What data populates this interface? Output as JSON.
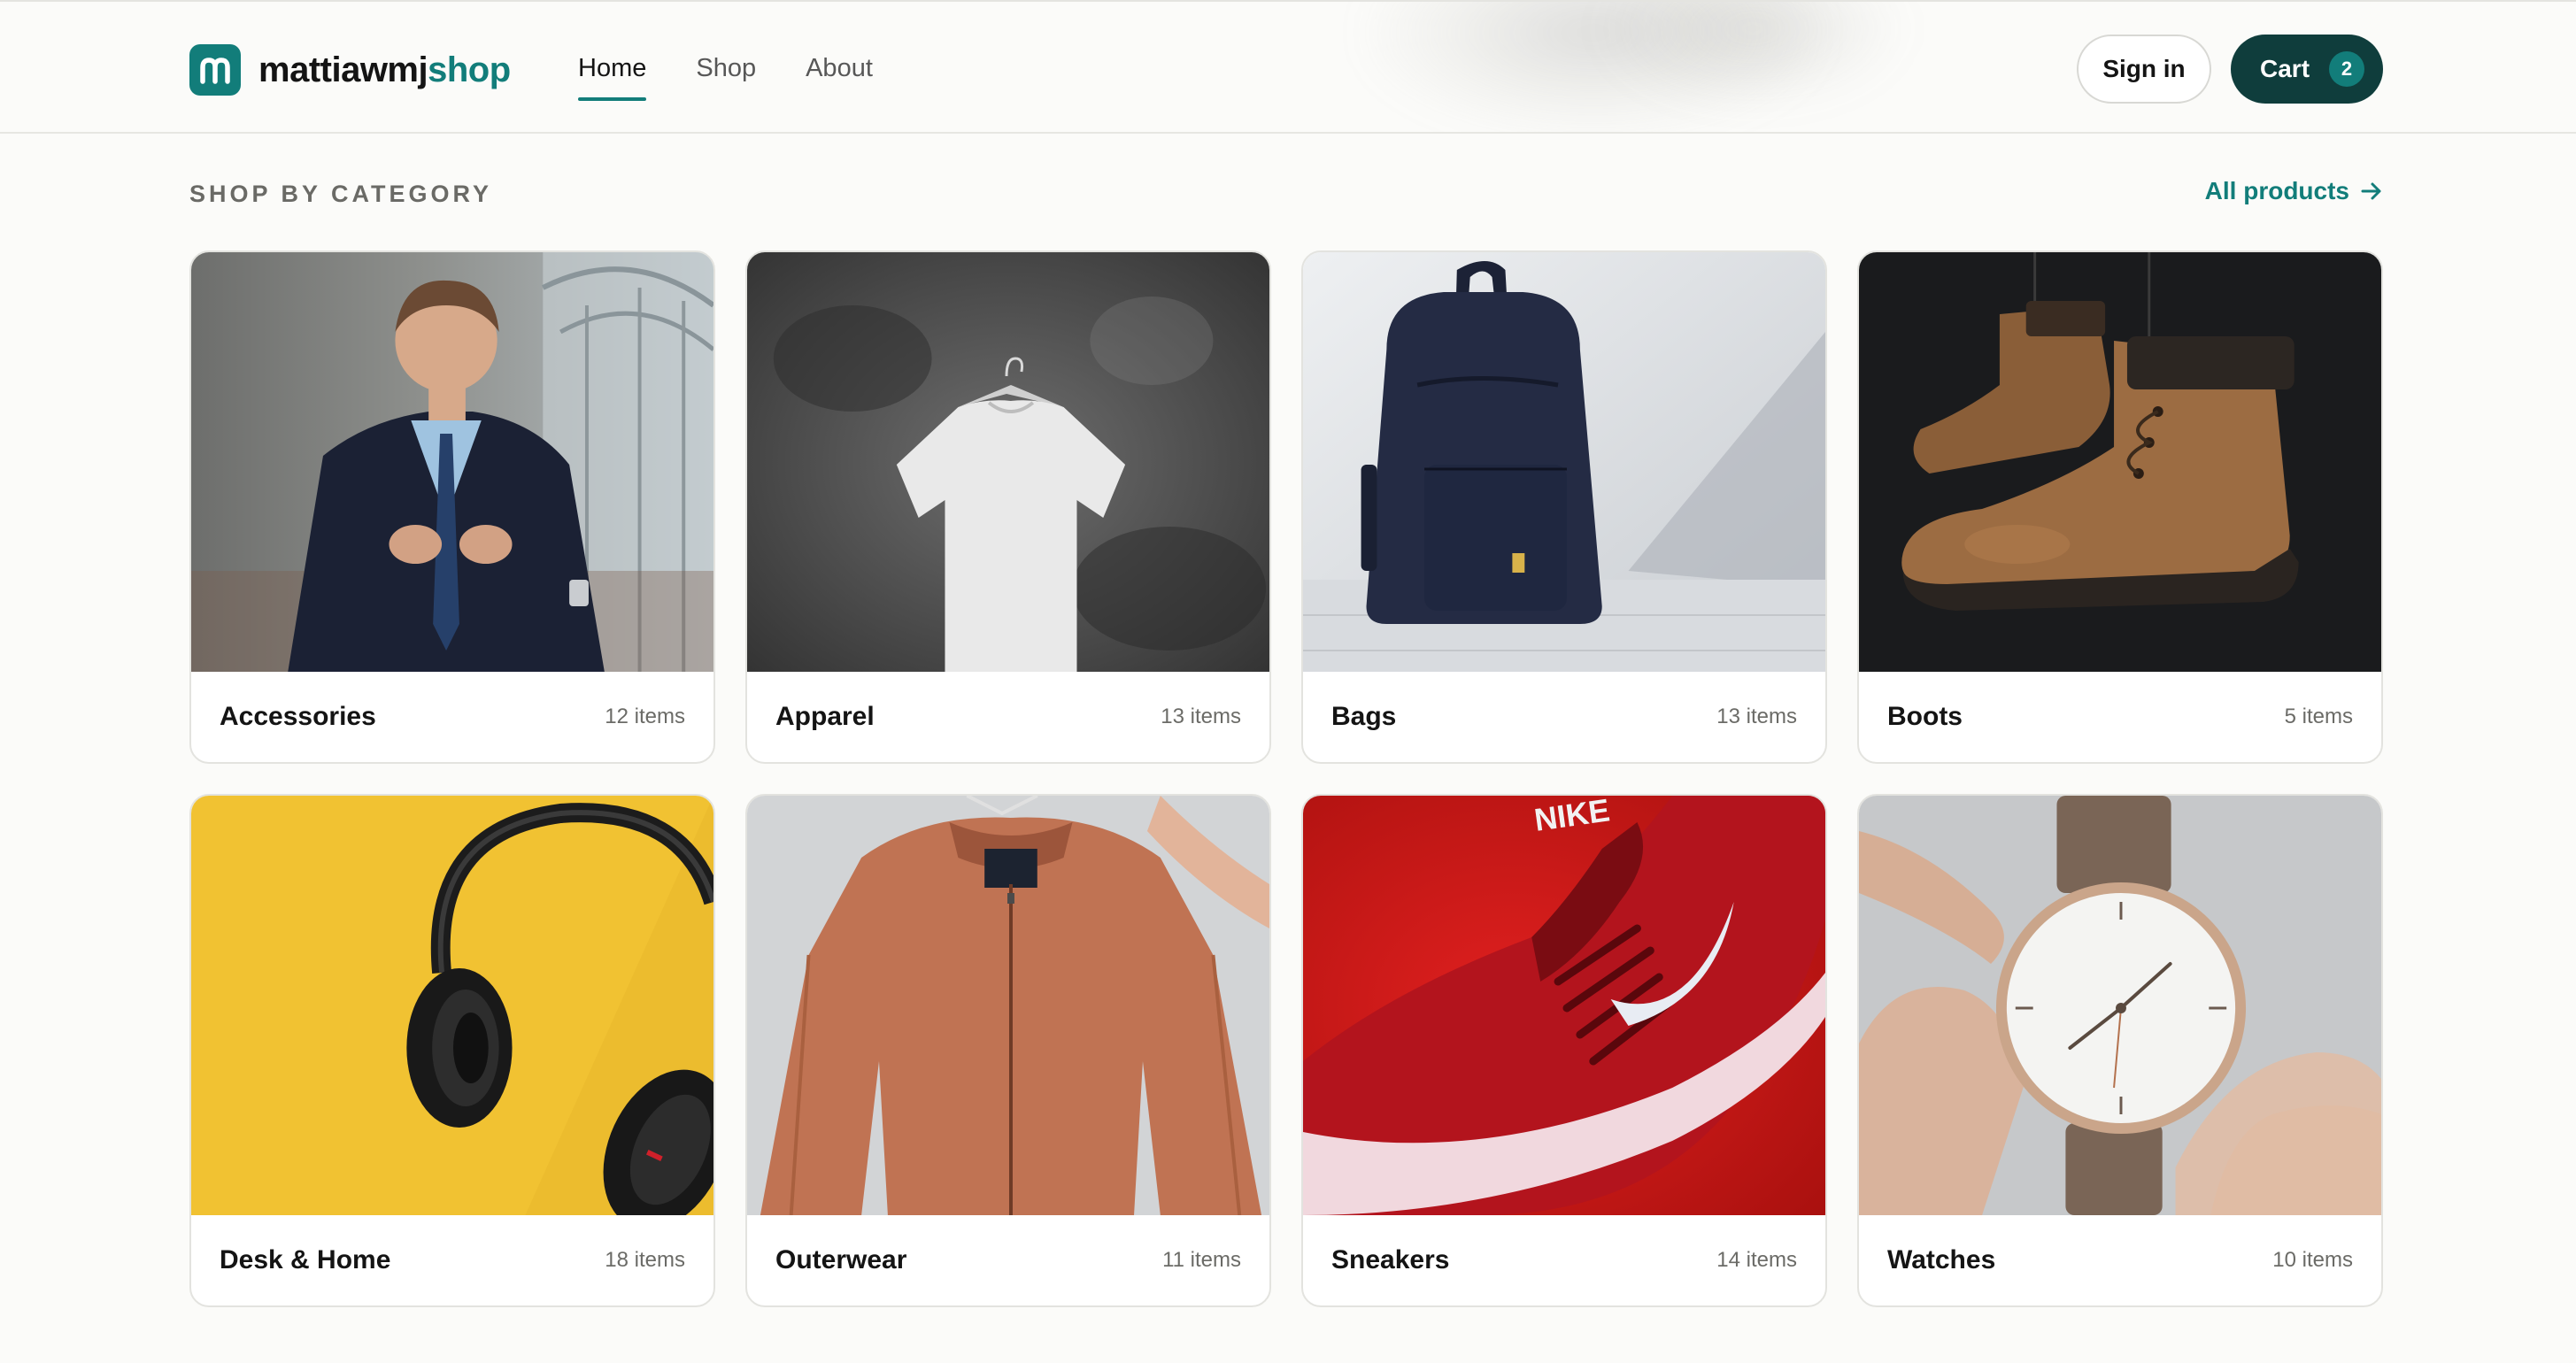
{
  "brand": {
    "name_part1": "mattiawmj",
    "name_part2": "shop",
    "logo_letter": "m",
    "color": "#127d7a"
  },
  "nav": {
    "items": [
      {
        "label": "Home",
        "active": true
      },
      {
        "label": "Shop",
        "active": false
      },
      {
        "label": "About",
        "active": false
      }
    ]
  },
  "actions": {
    "signin_label": "Sign in",
    "cart_label": "Cart",
    "cart_count": "2",
    "cart_color": "#0f3d3c"
  },
  "section": {
    "title": "SHOP BY CATEGORY",
    "all_products_label": "All products"
  },
  "categories": [
    {
      "name": "Accessories",
      "count": "12 items"
    },
    {
      "name": "Apparel",
      "count": "13 items"
    },
    {
      "name": "Bags",
      "count": "13 items"
    },
    {
      "name": "Boots",
      "count": "5 items"
    },
    {
      "name": "Desk & Home",
      "count": "18 items"
    },
    {
      "name": "Outerwear",
      "count": "11 items"
    },
    {
      "name": "Sneakers",
      "count": "14 items"
    },
    {
      "name": "Watches",
      "count": "10 items"
    }
  ],
  "icons": {
    "logo": "logo-m-icon",
    "arrow": "arrow-right-icon"
  }
}
